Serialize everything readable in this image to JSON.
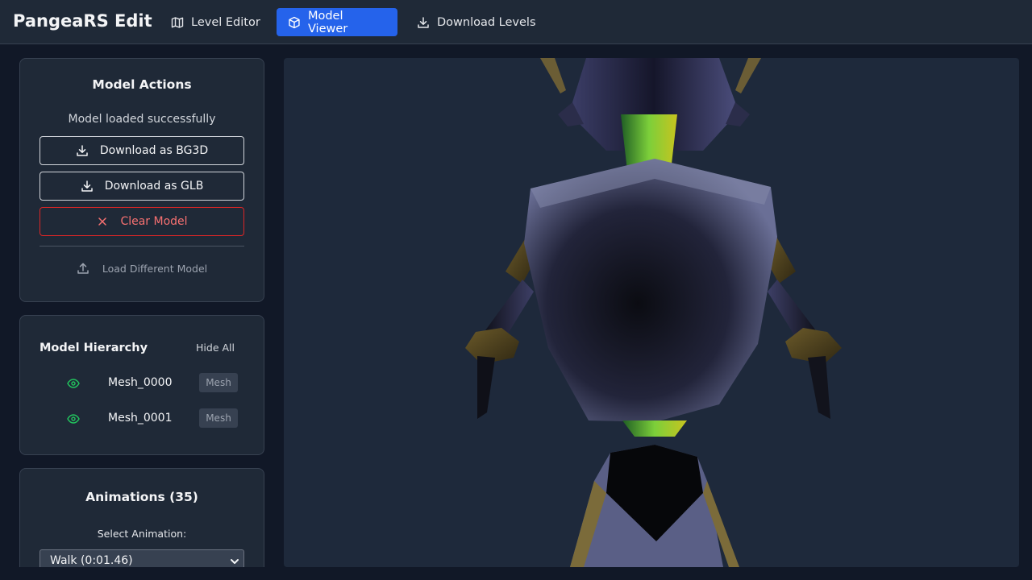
{
  "app": {
    "title": "PangeaRS Edit"
  },
  "nav": {
    "level_editor": "Level Editor",
    "model_viewer": "Model Viewer",
    "download_levels": "Download Levels"
  },
  "actions": {
    "title": "Model Actions",
    "status": "Model loaded successfully",
    "download_bg3d": "Download as BG3D",
    "download_glb": "Download as GLB",
    "clear": "Clear Model",
    "load_different": "Load Different Model"
  },
  "hierarchy": {
    "title": "Model Hierarchy",
    "hide_all": "Hide All",
    "items": [
      {
        "name": "Mesh_0000",
        "type": "Mesh"
      },
      {
        "name": "Mesh_0001",
        "type": "Mesh"
      }
    ]
  },
  "animations": {
    "title": "Animations (35)",
    "select_label": "Select Animation:",
    "selected": "Walk (0:01.46)"
  },
  "colors": {
    "accent": "#2563eb",
    "danger": "#dc2626",
    "visible_eye": "#22c55e"
  },
  "icons": [
    "map-icon",
    "cube-icon",
    "download-icon",
    "close-icon",
    "upload-icon",
    "eye-icon",
    "chevron-down-icon"
  ]
}
